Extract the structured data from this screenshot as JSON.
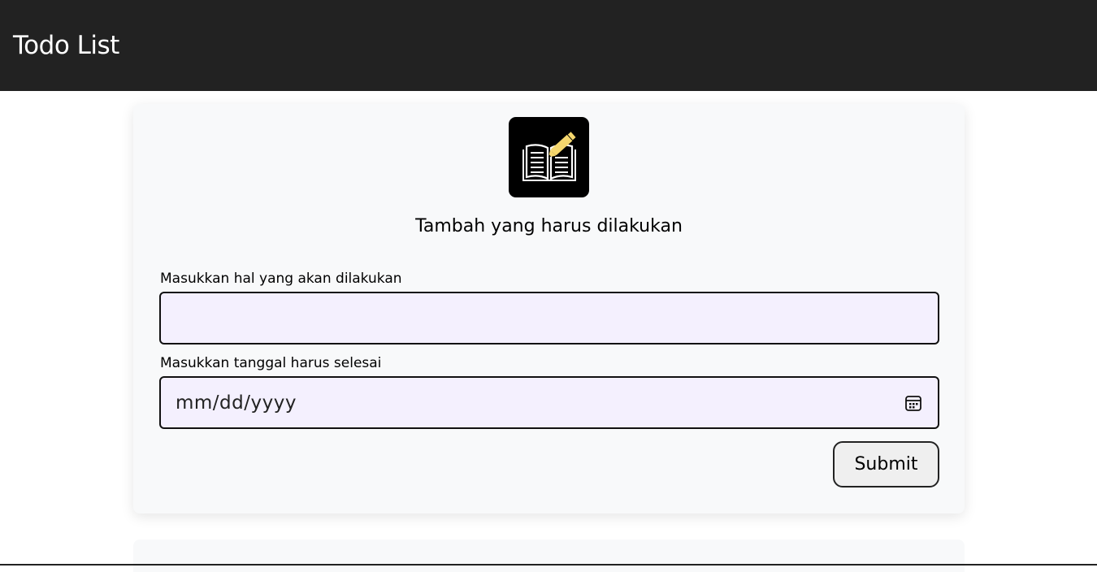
{
  "header": {
    "title": "Todo List"
  },
  "form": {
    "logo_icon": "open-book-pencil-icon",
    "title": "Tambah yang harus dilakukan",
    "todo_label": "Masukkan hal yang akan dilakukan",
    "todo_value": "",
    "date_label": "Masukkan tanggal harus selesai",
    "date_placeholder": "mm/dd/yyyy",
    "date_icon": "calendar-icon",
    "submit_label": "Submit"
  },
  "colors": {
    "header_bg": "#222222",
    "card_bg": "#f8f9fa",
    "input_bg": "#f4f0fe",
    "pencil": "#f5d76e"
  }
}
